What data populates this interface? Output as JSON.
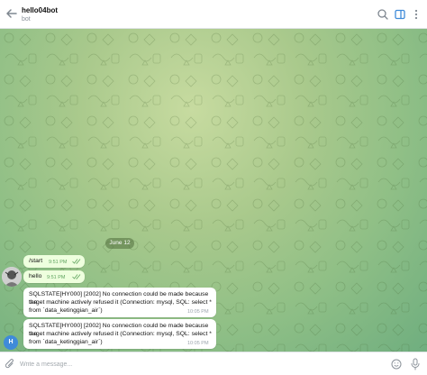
{
  "header": {
    "title": "hello04bot",
    "subtitle": "bot",
    "icons": [
      "back-arrow-icon",
      "search-icon",
      "sidebar-toggle-icon",
      "more-vertical-icon"
    ]
  },
  "chat": {
    "date_label": "June 12",
    "messages": [
      {
        "direction": "out",
        "text": "/start",
        "time": "9:51 PM",
        "status": "read"
      },
      {
        "direction": "out",
        "text": "hello",
        "time": "9:51 PM",
        "status": "read"
      },
      {
        "direction": "in",
        "line1": "SQLSTATE[HY000] [2002] No connection could be made because the",
        "line2": "target machine actively refused it (Connection: mysql, SQL: select *",
        "line3": "from `data_ketinggian_air`)",
        "time": "10:05 PM"
      },
      {
        "direction": "in",
        "line1": "SQLSTATE[HY000] [2002] No connection could be made because the",
        "line2": "target machine actively refused it (Connection: mysql, SQL: select *",
        "line3": "from `data_ketinggian_air`)",
        "time": "10:05 PM"
      }
    ]
  },
  "user_avatar": {
    "initial": "H",
    "color": "#3f8bd9"
  },
  "composer": {
    "placeholder": "Write a message..."
  },
  "colors": {
    "outgoing_bubble": "#eeffde",
    "incoming_bubble": "#ffffff",
    "accent": "#3f8bd9"
  }
}
